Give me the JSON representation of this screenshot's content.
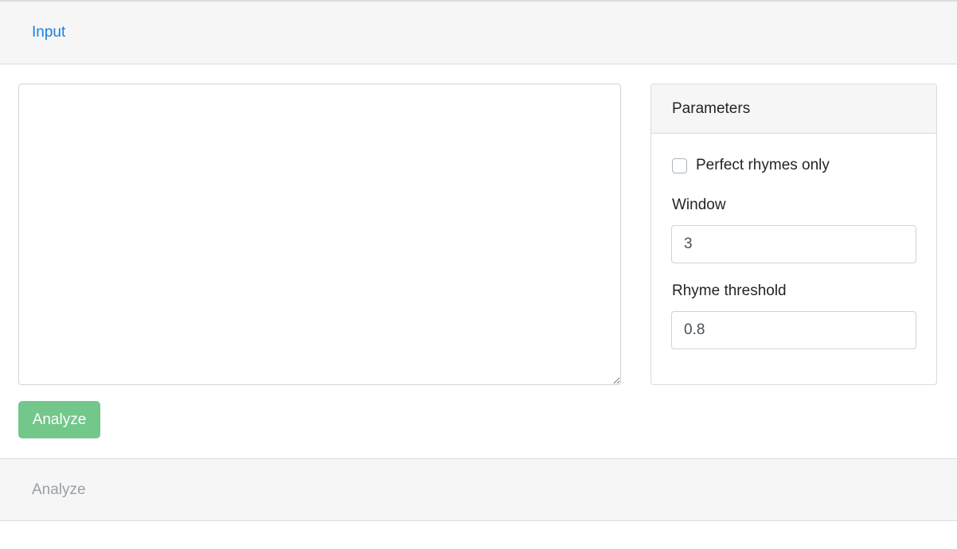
{
  "input_section": {
    "title": "Input"
  },
  "editor": {
    "value": "",
    "placeholder": ""
  },
  "parameters": {
    "title": "Parameters",
    "perfect_rhymes": {
      "label": "Perfect rhymes only",
      "checked": false
    },
    "window": {
      "label": "Window",
      "value": "3"
    },
    "rhyme_threshold": {
      "label": "Rhyme threshold",
      "value": "0.8"
    }
  },
  "actions": {
    "analyze_label": "Analyze"
  },
  "analyze_section": {
    "title": "Analyze"
  },
  "colors": {
    "link_active": "#1a7fe0",
    "link_inactive": "#9aa0a6",
    "button_success_disabled": "#73c78a",
    "header_background": "#f6f6f6"
  }
}
